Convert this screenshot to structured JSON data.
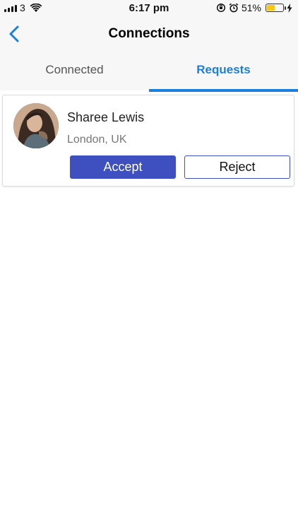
{
  "status_bar": {
    "carrier": "3",
    "time": "6:17 pm",
    "battery_percent_text": "51%",
    "battery_level": 0.51,
    "battery_color": "#f5c518"
  },
  "header": {
    "title": "Connections",
    "back_icon": "chevron-left-icon"
  },
  "tabs": [
    {
      "label": "Connected",
      "active": false
    },
    {
      "label": "Requests",
      "active": true
    }
  ],
  "requests": [
    {
      "name": "Sharee Lewis",
      "location": "London, UK",
      "accept_label": "Accept",
      "reject_label": "Reject"
    }
  ],
  "colors": {
    "accent": "#1a7fe0",
    "button_primary": "#3e4fbf"
  }
}
